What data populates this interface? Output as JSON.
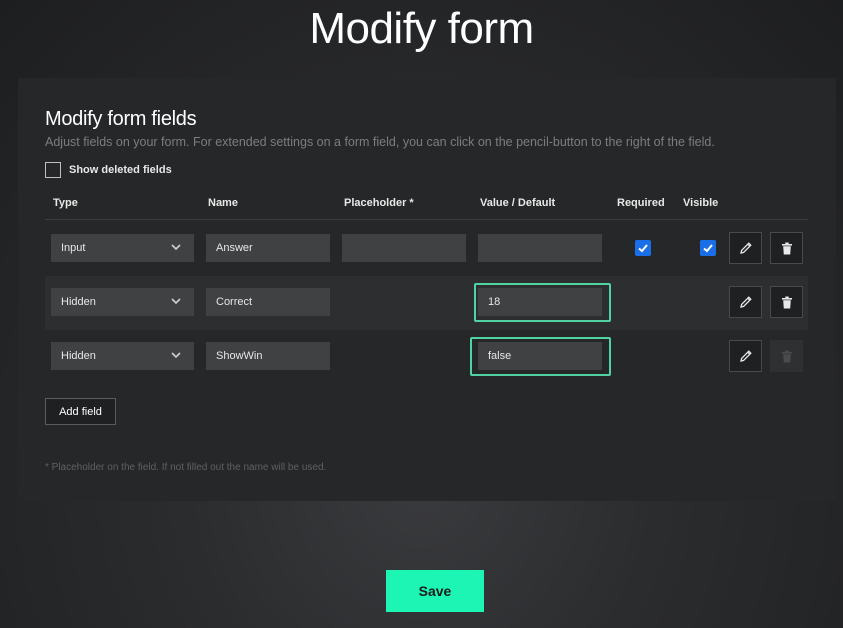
{
  "page": {
    "title": "Modify form"
  },
  "section": {
    "title": "Modify form fields",
    "description": "Adjust fields on your form. For extended settings on a form field, you can click on the pencil-button to the right of the field.",
    "show_deleted_label": "Show deleted fields",
    "show_deleted_checked": false
  },
  "table": {
    "headers": {
      "type": "Type",
      "name": "Name",
      "placeholder": "Placeholder *",
      "value": "Value / Default",
      "required": "Required",
      "visible": "Visible"
    },
    "rows": [
      {
        "type": "Input",
        "name": "Answer",
        "placeholder": "",
        "value": "",
        "required": true,
        "visible": true,
        "delete_enabled": true
      },
      {
        "type": "Hidden",
        "name": "Correct",
        "value": "18",
        "delete_enabled": true
      },
      {
        "type": "Hidden",
        "name": "ShowWin",
        "value": "false",
        "delete_enabled": false
      }
    ]
  },
  "add_field_label": "Add field",
  "footnote": "* Placeholder on the field. If not filled out the name will be used.",
  "save_label": "Save",
  "colors": {
    "accent": "#1cf5b3",
    "checkbox": "#1a6fe8",
    "focus_outline": "#4fd3a3",
    "panel": "#262728",
    "input_bg": "#404143"
  },
  "icons": {
    "dropdown": "chevron-down-icon",
    "edit": "pencil-icon",
    "delete": "trash-icon",
    "check": "checkmark-icon"
  }
}
